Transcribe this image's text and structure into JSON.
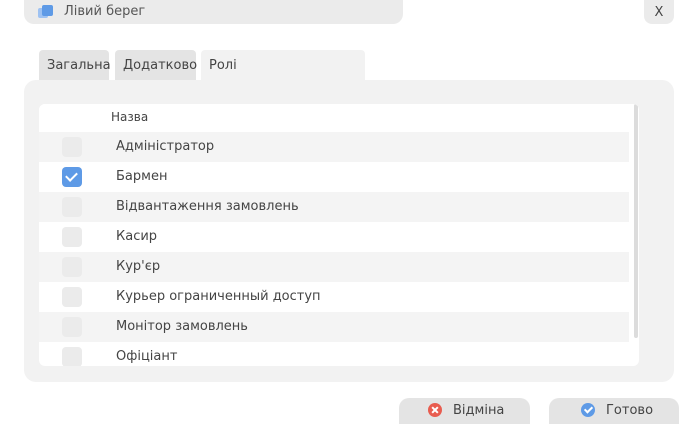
{
  "window": {
    "title": "Лівий берег",
    "close_label": "X"
  },
  "tabs": [
    {
      "label": "Загальна",
      "active": false
    },
    {
      "label": "Додатково",
      "active": false
    },
    {
      "label": "Ролі",
      "active": true
    }
  ],
  "table": {
    "header": "Назва",
    "rows": [
      {
        "label": "Адміністратор",
        "checked": false
      },
      {
        "label": "Бармен",
        "checked": true
      },
      {
        "label": "Відвантаження замовлень",
        "checked": false
      },
      {
        "label": "Касир",
        "checked": false
      },
      {
        "label": "Кур'єр",
        "checked": false
      },
      {
        "label": "Курьер ограниченный доступ",
        "checked": false
      },
      {
        "label": "Монітор замовлень",
        "checked": false
      },
      {
        "label": "Офіціант",
        "checked": false
      }
    ]
  },
  "footer": {
    "cancel_label": "Відміна",
    "ok_label": "Готово"
  },
  "colors": {
    "accent": "#5e9ae6",
    "cancel": "#e85c4f"
  },
  "icons": {
    "app": "app-windows-icon",
    "check": "checkmark-icon",
    "cancel": "cancel-circle-icon",
    "ok": "check-circle-icon"
  }
}
